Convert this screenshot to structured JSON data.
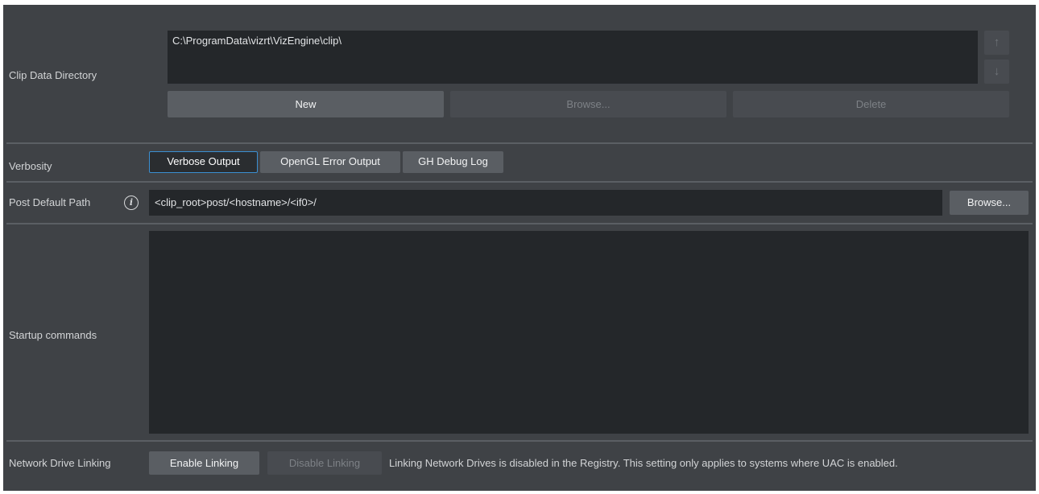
{
  "clip_data": {
    "label": "Clip Data Directory",
    "paths": [
      "C:\\ProgramData\\vizrt\\VizEngine\\clip\\"
    ],
    "up_icon": "arrow-up-icon",
    "down_icon": "arrow-down-icon",
    "new_label": "New",
    "browse_label": "Browse...",
    "delete_label": "Delete"
  },
  "verbosity": {
    "label": "Verbosity",
    "options": [
      {
        "label": "Verbose Output",
        "active": true
      },
      {
        "label": "OpenGL Error Output",
        "active": false
      },
      {
        "label": "GH Debug Log",
        "active": false
      }
    ]
  },
  "post_path": {
    "label": "Post Default Path",
    "info_icon": "info-icon",
    "info_glyph": "i",
    "value": "<clip_root>post/<hostname>/<if0>/",
    "browse_label": "Browse..."
  },
  "startup": {
    "label": "Startup commands",
    "value": ""
  },
  "network": {
    "label": "Network Drive Linking",
    "enable_label": "Enable Linking",
    "disable_label": "Disable Linking",
    "note": "Linking Network Drives is disabled in the Registry. This setting only applies to systems where UAC is enabled."
  },
  "colors": {
    "panel": "#3f4246",
    "field": "#24272a",
    "button": "#5a5e63",
    "accent": "#3b8fd1"
  }
}
